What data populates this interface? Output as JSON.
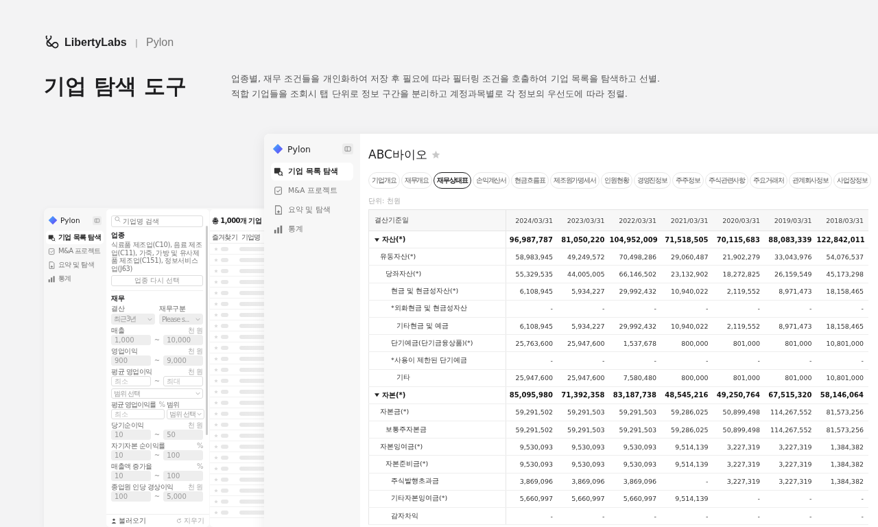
{
  "brand": {
    "name": "LibertyLabs",
    "separator": "|",
    "product": "Pylon"
  },
  "hero": {
    "title": "기업 탐색 도구",
    "description": [
      "업종별, 재무 조건들을 개인화하여 저장 후 필요에 따라 필터링 조건을 호출하여 기업 목록을 탐색하고 선별.",
      "적합 기업들을 조회시 탭 단위로 정보 구간을 분리하고 계정과목별로 각 정보의 우선도에 따라 정렬."
    ]
  },
  "back_window": {
    "sidebar": {
      "app_name": "Pylon",
      "items": [
        {
          "label": "기업 목록 탐색",
          "selected": true
        },
        {
          "label": "M&A 프로젝트",
          "selected": false
        },
        {
          "label": "요약 및 탐색",
          "selected": false
        },
        {
          "label": "통계",
          "selected": false
        }
      ]
    },
    "filters": {
      "search": {
        "placeholder": "기업명 검색"
      },
      "industry": {
        "heading": "업종",
        "text": "식료품 제조업(C10), 음료 제조업(C11), 가죽, 가방 및 유사제품 제조업(C151), 정보서비스업(J63)",
        "button": "업종 다시 선택"
      },
      "finance": {
        "heading": "재무",
        "selects": [
          {
            "label": "결산",
            "value": "최근3년",
            "disabled": true
          },
          {
            "label": "재무구분",
            "value": "Please s...",
            "disabled": true
          }
        ],
        "fields": [
          {
            "kind": "range",
            "label": "매출",
            "unit": "천 원",
            "min": {
              "value": "1,000"
            },
            "max": {
              "value": "10,000"
            },
            "sep": "~",
            "disabled": true
          },
          {
            "kind": "range",
            "label": "영업이익",
            "unit": "천 원",
            "min": {
              "value": "900"
            },
            "max": {
              "value": "9,000"
            },
            "sep": "~",
            "disabled": true
          },
          {
            "kind": "range",
            "label": "평균 영업이익",
            "unit": "천 원",
            "min": {
              "placeholder": "최소"
            },
            "max": {
              "placeholder": "최대"
            },
            "sep": "~",
            "disabled": false
          },
          {
            "kind": "select",
            "placeholder": "범위 선택"
          },
          {
            "kind": "pair",
            "label": "평균 영업이익률",
            "unit": "%",
            "label2": "범위",
            "input": {
              "placeholder": "최소"
            },
            "select": {
              "placeholder": "범위 선택"
            }
          },
          {
            "kind": "range",
            "label": "당기순이익",
            "unit": "천 원",
            "min": {
              "value": "10"
            },
            "max": {
              "value": "50"
            },
            "sep": "~",
            "disabled": true
          },
          {
            "kind": "range",
            "label": "자기자본 순이익률",
            "unit": "%",
            "min": {
              "value": "10"
            },
            "max": {
              "value": "100"
            },
            "sep": "~",
            "disabled": true
          },
          {
            "kind": "range",
            "label": "매출액 증가율",
            "unit": "%",
            "min": {
              "value": "10"
            },
            "max": {
              "value": "100"
            },
            "sep": "~",
            "disabled": true
          },
          {
            "kind": "range",
            "label": "종업원 인당 경상이익",
            "unit": "천 원",
            "min": {
              "value": "100"
            },
            "max": {
              "value": "5,000"
            },
            "sep": "~",
            "disabled": true
          }
        ]
      },
      "footer": {
        "load": "불러오기",
        "clear": "지우기"
      }
    },
    "list": {
      "count": "총 1,000개 기업",
      "columns": [
        "즐겨찾기",
        "기업명"
      ],
      "rows": [
        {
          "favorite": false
        },
        {
          "favorite": false
        },
        {
          "favorite": false
        },
        {
          "favorite": false
        },
        {
          "favorite": false
        },
        {
          "favorite": false
        },
        {
          "favorite": false
        },
        {
          "favorite": false
        },
        {
          "favorite": false
        },
        {
          "favorite": false
        },
        {
          "favorite": false
        },
        {
          "favorite": false
        },
        {
          "favorite": false
        },
        {
          "favorite": false
        },
        {
          "favorite": false
        },
        {
          "favorite": false
        },
        {
          "favorite": false
        },
        {
          "favorite": false
        },
        {
          "favorite": false
        },
        {
          "favorite": false
        },
        {
          "favorite": false
        },
        {
          "favorite": false
        },
        {
          "favorite": false
        },
        {
          "favorite": false
        },
        {
          "favorite": false
        }
      ]
    }
  },
  "window": {
    "sidebar": {
      "app_name": "Pylon",
      "items": [
        {
          "label": "기업 목록 탐색",
          "selected": true
        },
        {
          "label": "M&A 프로젝트",
          "selected": false
        },
        {
          "label": "요약 및 탐색",
          "selected": false
        },
        {
          "label": "통계",
          "selected": false
        }
      ]
    },
    "company": {
      "name": "ABC바이오",
      "favorite": false
    },
    "tabs": [
      {
        "label": "기업개요",
        "selected": false
      },
      {
        "label": "재무개요",
        "selected": false
      },
      {
        "label": "재무상태표",
        "selected": true
      },
      {
        "label": "손익계산서",
        "selected": false
      },
      {
        "label": "현금흐름표",
        "selected": false
      },
      {
        "label": "제조원가명세서",
        "selected": false
      },
      {
        "label": "인원현황",
        "selected": false
      },
      {
        "label": "경영진정보",
        "selected": false
      },
      {
        "label": "주주정보",
        "selected": false
      },
      {
        "label": "주식관련사항",
        "selected": false
      },
      {
        "label": "주요거래처",
        "selected": false
      },
      {
        "label": "관계회사정보",
        "selected": false
      },
      {
        "label": "사업장정보",
        "selected": false
      }
    ],
    "unit": "단위: 천원",
    "table": {
      "columns": [
        "결산기준일",
        "2024/03/31",
        "2023/03/31",
        "2022/03/31",
        "2021/03/31",
        "2020/03/31",
        "2019/03/31",
        "2018/03/31"
      ],
      "rows": [
        {
          "label": "자산(*)",
          "expanded": true,
          "values": [
            "96,987,787",
            "81,050,220",
            "104,952,009",
            "71,518,505",
            "70,115,683",
            "88,083,339",
            "122,842,011"
          ],
          "children": [
            {
              "label": "유동자산(*)",
              "values": [
                "58,983,945",
                "49,249,572",
                "70,498,286",
                "29,060,487",
                "21,902,279",
                "33,043,976",
                "54,076,537"
              ],
              "children": [
                {
                  "label": "당좌자산(*)",
                  "values": [
                    "55,329,535",
                    "44,005,005",
                    "66,146,502",
                    "23,132,902",
                    "18,272,825",
                    "26,159,549",
                    "45,173,298"
                  ],
                  "children": [
                    {
                      "label": "현금 및 현금성자산(*)",
                      "values": [
                        "6,108,945",
                        "5,934,227",
                        "29,992,432",
                        "10,940,022",
                        "2,119,552",
                        "8,971,473",
                        "18,158,465"
                      ]
                    },
                    {
                      "label": "*외화현금 및 현금성자산",
                      "values": [
                        "-",
                        "-",
                        "-",
                        "-",
                        "-",
                        "-",
                        "-"
                      ],
                      "children": [
                        {
                          "label": "기타현금 및 예금",
                          "values": [
                            "6,108,945",
                            "5,934,227",
                            "29,992,432",
                            "10,940,022",
                            "2,119,552",
                            "8,971,473",
                            "18,158,465"
                          ]
                        }
                      ]
                    },
                    {
                      "label": "단기예금(단기금융상품)(*)",
                      "values": [
                        "25,763,600",
                        "25,947,600",
                        "1,537,678",
                        "800,000",
                        "801,000",
                        "801,000",
                        "10,801,000"
                      ]
                    },
                    {
                      "label": "*사용이 제한된 단기예금",
                      "values": [
                        "-",
                        "-",
                        "-",
                        "-",
                        "-",
                        "-",
                        "-"
                      ],
                      "children": [
                        {
                          "label": "기타",
                          "values": [
                            "25,947,600",
                            "25,947,600",
                            "7,580,480",
                            "800,000",
                            "801,000",
                            "801,000",
                            "10,801,000"
                          ]
                        }
                      ]
                    }
                  ]
                }
              ]
            }
          ]
        },
        {
          "label": "자본(*)",
          "expanded": true,
          "values": [
            "85,095,980",
            "71,392,358",
            "83,187,738",
            "48,545,216",
            "49,250,764",
            "67,515,320",
            "58,146,064"
          ],
          "children": [
            {
              "label": "자본금(*)",
              "values": [
                "59,291,502",
                "59,291,503",
                "59,291,503",
                "59,286,025",
                "50,899,498",
                "114,267,552",
                "81,573,256"
              ],
              "children": [
                {
                  "label": "보통주자본금",
                  "values": [
                    "59,291,502",
                    "59,291,503",
                    "59,291,503",
                    "59,286,025",
                    "50,899,498",
                    "114,267,552",
                    "81,573,256"
                  ]
                }
              ]
            },
            {
              "label": "자본잉여금(*)",
              "values": [
                "9,530,093",
                "9,530,093",
                "9,530,093",
                "9,514,139",
                "3,227,319",
                "3,227,319",
                "1,384,382"
              ],
              "children": [
                {
                  "label": "자본준비금(*)",
                  "values": [
                    "9,530,093",
                    "9,530,093",
                    "9,530,093",
                    "9,514,139",
                    "3,227,319",
                    "3,227,319",
                    "1,384,382"
                  ],
                  "children": [
                    {
                      "label": "주식발행초과금",
                      "values": [
                        "3,869,096",
                        "3,869,096",
                        "3,869,096",
                        "-",
                        "3,227,319",
                        "3,227,319",
                        "1,384,382"
                      ]
                    },
                    {
                      "label": "기타자본잉여금(*)",
                      "values": [
                        "5,660,997",
                        "5,660,997",
                        "5,660,997",
                        "9,514,139",
                        "-",
                        "-",
                        "-"
                      ]
                    },
                    {
                      "label": "감자차익",
                      "values": [
                        "-",
                        "-",
                        "-",
                        "-",
                        "-",
                        "-",
                        "-"
                      ]
                    }
                  ]
                }
              ]
            }
          ]
        }
      ]
    }
  }
}
